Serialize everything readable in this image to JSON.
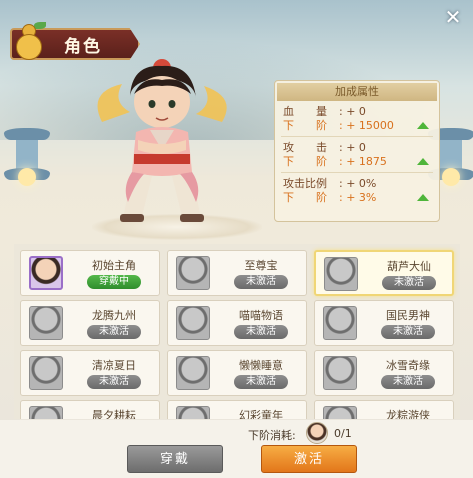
{
  "header": {
    "title": "角色"
  },
  "stats": {
    "title": "加成属性",
    "groups": [
      {
        "name": "血　　量",
        "current": ": + 0",
        "next_label": "下　　阶",
        "next": ": + 15000"
      },
      {
        "name": "攻　　击",
        "current": ": + 0",
        "next_label": "下　　阶",
        "next": ": + 1875"
      },
      {
        "name": "攻击比例",
        "current": ": + 0%",
        "next_label": "下　　阶",
        "next": ": + 3%"
      }
    ]
  },
  "roster": [
    {
      "name": "初始主角",
      "status": "穿戴中"
    },
    {
      "name": "至尊宝",
      "status": "未激活"
    },
    {
      "name": "葫芦大仙",
      "status": "未激活"
    },
    {
      "name": "龙腾九州",
      "status": "未激活"
    },
    {
      "name": "喵喵物语",
      "status": "未激活"
    },
    {
      "name": "国民男神",
      "status": "未激活"
    },
    {
      "name": "清凉夏日",
      "status": "未激活"
    },
    {
      "name": "懒懒睡意",
      "status": "未激活"
    },
    {
      "name": "冰雪奇缘",
      "status": "未激活"
    },
    {
      "name": "晨夕耕耘",
      "status": ""
    },
    {
      "name": "幻彩童年",
      "status": ""
    },
    {
      "name": "龙粽游侠",
      "status": ""
    }
  ],
  "footer": {
    "cost_label": "下阶消耗:",
    "cost_value": "0/1",
    "wear_button": "穿戴",
    "activate_button": "激活"
  },
  "colors": {
    "accent_orange": "#e2761a",
    "status_green": "#2f8d2c",
    "selected_border": "#f0d676"
  },
  "icons": [
    "close-icon",
    "gourd-icon",
    "arrow-up-icon",
    "fragment-icon"
  ]
}
